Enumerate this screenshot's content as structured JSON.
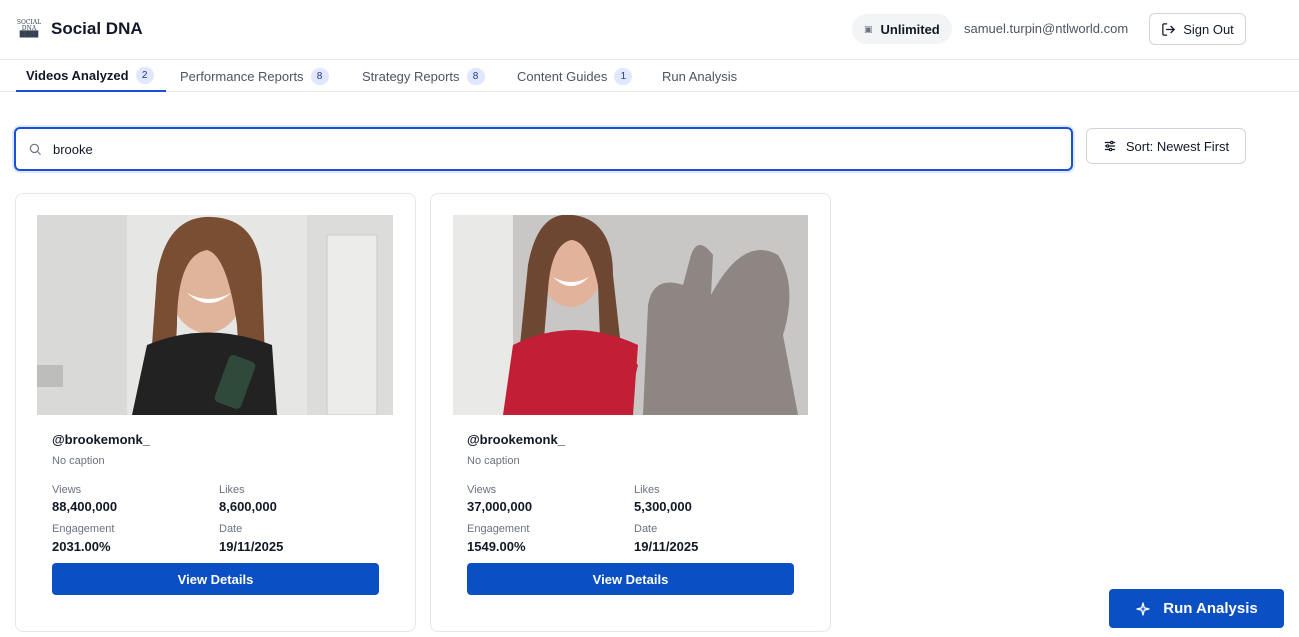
{
  "header": {
    "logo_text": [
      "SOCIAL",
      "DNA",
      "████"
    ],
    "title": "Social DNA",
    "plan": "Unlimited",
    "email": "samuel.turpin@ntlworld.com",
    "sign_out": "Sign Out"
  },
  "tabs": [
    {
      "label": "Videos Analyzed",
      "count": "2"
    },
    {
      "label": "Performance Reports",
      "count": "8"
    },
    {
      "label": "Strategy Reports",
      "count": "8"
    },
    {
      "label": "Content Guides",
      "count": "1"
    },
    {
      "label": "Run Analysis"
    }
  ],
  "search": {
    "value": "brooke"
  },
  "sort_label": "Sort: Newest First",
  "cards": [
    {
      "handle": "@brookemonk_",
      "caption": "No caption",
      "views_label": "Views",
      "views": "88,400,000",
      "likes_label": "Likes",
      "likes": "8,600,000",
      "engagement_label": "Engagement",
      "engagement": "2031.00%",
      "date_label": "Date",
      "date": "19/11/2025",
      "button": "View Details"
    },
    {
      "handle": "@brookemonk_",
      "caption": "No caption",
      "views_label": "Views",
      "views": "37,000,000",
      "likes_label": "Likes",
      "likes": "5,300,000",
      "engagement_label": "Engagement",
      "engagement": "1549.00%",
      "date_label": "Date",
      "date": "19/11/2025",
      "button": "View Details"
    }
  ],
  "run_button": "Run Analysis",
  "colors": {
    "primary": "#0b4fc4",
    "border": "#e5e7eb",
    "badge": "#e0e7ff"
  }
}
